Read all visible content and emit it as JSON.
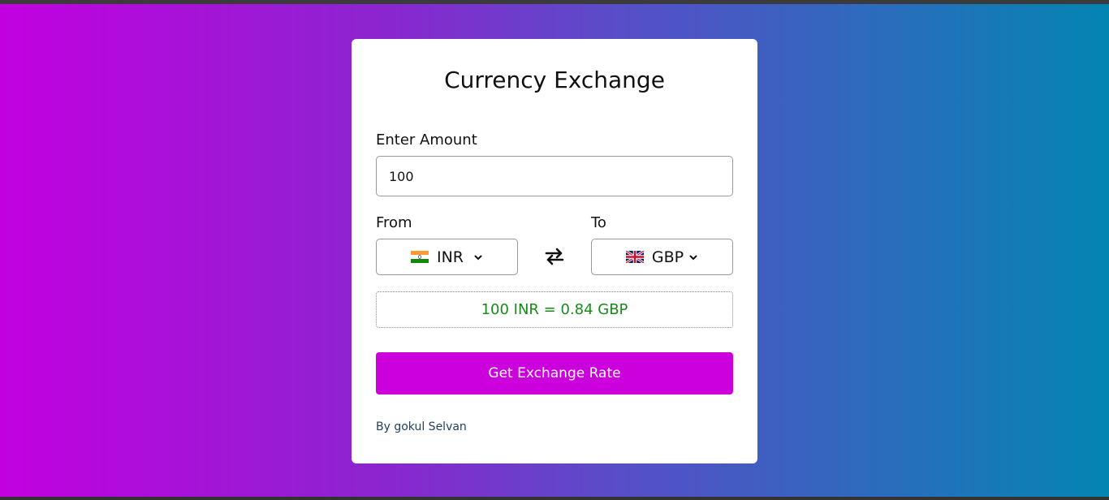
{
  "page": {
    "title": "Currency Exchange",
    "amount_label": "Enter Amount",
    "amount_value": "100",
    "from_label": "From",
    "to_label": "To",
    "from_currency": {
      "code": "INR",
      "flag": "india-flag-icon"
    },
    "to_currency": {
      "code": "GBP",
      "flag": "uk-flag-icon"
    },
    "swap_icon": "swap-arrows-icon",
    "result_text": "100 INR = 0.84 GBP",
    "button_label": "Get Exchange Rate",
    "footer_text": "By gokul Selvan"
  },
  "colors": {
    "button": "#cc00dd",
    "result_text": "#1a8a1a",
    "gradient_start": "#c200e0",
    "gradient_end": "#0385b2"
  }
}
